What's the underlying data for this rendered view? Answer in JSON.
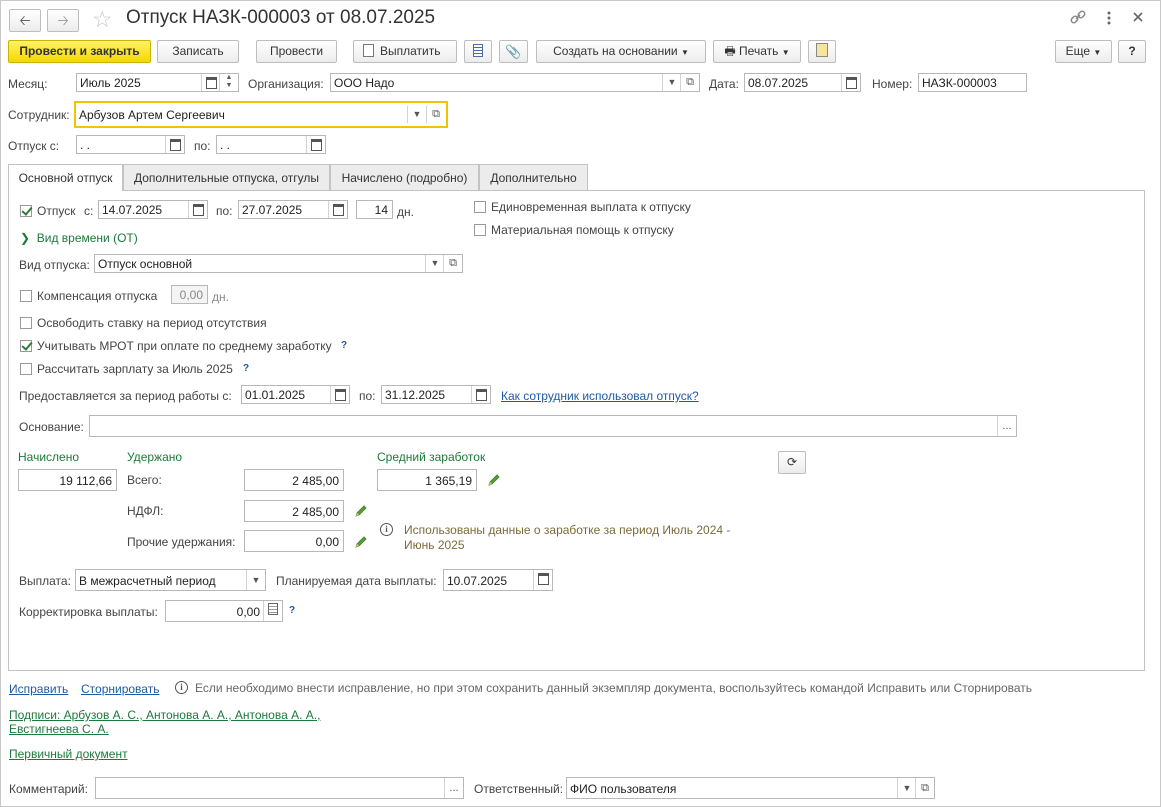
{
  "window": {
    "title": "Отпуск НАЗК-000003 от 08.07.2025"
  },
  "icons": {
    "back": "arrow-left-icon",
    "forward": "arrow-right-icon",
    "favorite": "star-icon",
    "link": "link-icon",
    "more": "vertical-dots-icon",
    "close": "close-icon"
  },
  "toolbar": {
    "post_close": "Провести и закрыть",
    "save": "Записать",
    "post": "Провести",
    "pay": "Выплатить",
    "create_basis": "Создать на основании",
    "print": "Печать",
    "more": "Еще",
    "help": "?"
  },
  "header": {
    "month_label": "Месяц:",
    "month_value": "Июль 2025",
    "org_label": "Организация:",
    "org_value": "ООО Надо",
    "date_label": "Дата:",
    "date_value": "08.07.2025",
    "number_label": "Номер:",
    "number_value": "НАЗК-000003",
    "employee_label": "Сотрудник:",
    "employee_value": "Арбузов Артем Сергеевич",
    "leave_from_label": "Отпуск с:",
    "leave_from_value": " .  .",
    "leave_to_label": "по:",
    "leave_to_value": " .  ."
  },
  "tabs": [
    {
      "label": "Основной отпуск"
    },
    {
      "label": "Дополнительные отпуска, отгулы"
    },
    {
      "label": "Начислено (подробно)"
    },
    {
      "label": "Дополнительно"
    }
  ],
  "main": {
    "leave_checkbox": "Отпуск",
    "from_label": "с:",
    "from_value": "14.07.2025",
    "to_label": "по:",
    "to_value": "27.07.2025",
    "days_value": "14",
    "days_unit": "дн.",
    "time_kind": "Вид времени (ОТ)",
    "one_time_payment": "Единовременная выплата к отпуску",
    "material_aid": "Материальная помощь к отпуску",
    "leave_type_label": "Вид отпуска:",
    "leave_type_value": "Отпуск основной",
    "compensation": "Компенсация отпуска",
    "compensation_value": "0,00",
    "compensation_unit": "дн.",
    "release_rate": "Освободить ставку на период отсутствия",
    "consider_mrot": "Учитывать МРОТ при оплате по среднему заработку",
    "calc_salary": "Рассчитать зарплату за Июль 2025",
    "period_label": "Предоставляется за период работы с:",
    "period_from": "01.01.2025",
    "period_to_label": "по:",
    "period_to": "31.12.2025",
    "how_used_link": "Как сотрудник использовал отпуск?",
    "basis_label": "Основание:",
    "basis_value": "",
    "accrued_label": "Начислено",
    "accrued_value": "19 112,66",
    "withheld_label": "Удержано",
    "total_label": "Всего:",
    "total_value": "2 485,00",
    "ndfl_label": "НДФЛ:",
    "ndfl_value": "2 485,00",
    "other_label": "Прочие удержания:",
    "other_value": "0,00",
    "avg_label": "Средний заработок",
    "avg_value": "1 365,19",
    "info_text_1": "Использованы данные о заработке за период Июль 2024 -",
    "info_text_2": "Июнь 2025",
    "payout_label": "Выплата:",
    "payout_value": "В межрасчетный период",
    "planned_date_label": "Планируемая дата выплаты:",
    "planned_date_value": "10.07.2025",
    "correction_label": "Корректировка выплаты:",
    "correction_value": "0,00",
    "help_mark": "?"
  },
  "footer": {
    "fix_link": "Исправить",
    "storno_link": "Сторнировать",
    "fix_hint": "Если необходимо внести исправление, но при этом сохранить данный экземпляр документа, воспользуйтесь командой Исправить или Сторнировать",
    "signatures_1": "Подписи: Арбузов А. С., Антонова А. А., Антонова А. А.,",
    "signatures_2": "Евстигнеева С. А.",
    "primary_doc": "Первичный документ",
    "comment_label": "Комментарий:",
    "comment_value": "",
    "responsible_label": "Ответственный:",
    "responsible_value": "ФИО пользователя",
    "ellipsis": "..."
  },
  "colors": {
    "primary_button": "#f5d800",
    "link": "#1d5aa6",
    "green_link": "#1b7a3a",
    "focus_border": "#f0c400"
  }
}
